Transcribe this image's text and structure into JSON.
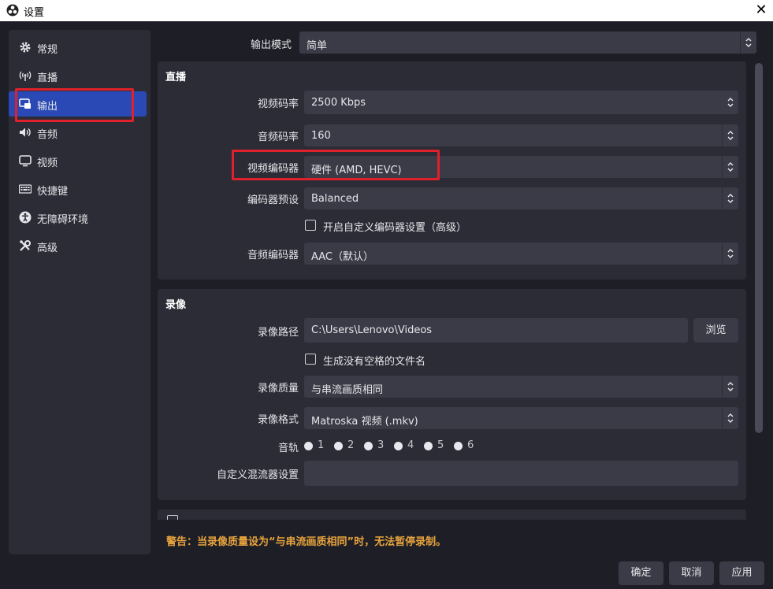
{
  "window": {
    "title": "设置"
  },
  "sidebar": {
    "items": [
      {
        "label": "常规",
        "icon": "gear-icon"
      },
      {
        "label": "直播",
        "icon": "antenna-icon"
      },
      {
        "label": "输出",
        "icon": "output-icon",
        "active": true
      },
      {
        "label": "音频",
        "icon": "speaker-icon"
      },
      {
        "label": "视频",
        "icon": "monitor-icon"
      },
      {
        "label": "快捷键",
        "icon": "keyboard-icon"
      },
      {
        "label": "无障碍环境",
        "icon": "accessibility-icon"
      },
      {
        "label": "高级",
        "icon": "tools-icon"
      }
    ]
  },
  "output_mode": {
    "label": "输出模式",
    "value": "简单"
  },
  "streaming": {
    "title": "直播",
    "video_bitrate": {
      "label": "视频码率",
      "value": "2500 Kbps"
    },
    "audio_bitrate": {
      "label": "音频码率",
      "value": "160"
    },
    "video_encoder": {
      "label": "视频编码器",
      "value": "硬件 (AMD, HEVC)"
    },
    "encoder_preset": {
      "label": "编码器预设",
      "value": "Balanced"
    },
    "custom_encoder_checkbox": "开启自定义编码器设置（高级）",
    "audio_encoder": {
      "label": "音频编码器",
      "value": "AAC（默认）"
    }
  },
  "recording": {
    "title": "录像",
    "path": {
      "label": "录像路径",
      "value": "C:\\Users\\Lenovo\\Videos",
      "browse": "浏览"
    },
    "no_space_checkbox": "生成没有空格的文件名",
    "quality": {
      "label": "录像质量",
      "value": "与串流画质相同"
    },
    "format": {
      "label": "录像格式",
      "value": "Matroska 视频 (.mkv)"
    },
    "tracks": {
      "label": "音轨",
      "numbers": [
        "1",
        "2",
        "3",
        "4",
        "5",
        "6"
      ]
    },
    "muxer": {
      "label": "自定义混流器设置",
      "value": ""
    }
  },
  "warning": "警告：当录像质量设为“与串流画质相同”时，无法暂停录制。",
  "buttons": {
    "ok": "确定",
    "cancel": "取消",
    "apply": "应用"
  },
  "colors": {
    "accent": "#2b49b4",
    "highlight_box": "#e0202a",
    "warning": "#e8a33d"
  }
}
